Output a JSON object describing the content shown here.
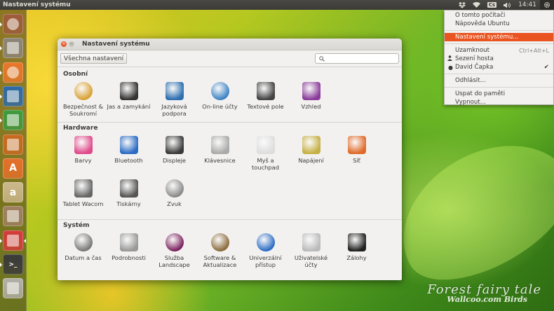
{
  "panel": {
    "app_title": "Nastavení systému",
    "clock": "14:41",
    "cs_badge": "Cs"
  },
  "launcher": {
    "items": [
      {
        "name": "dash-home",
        "icon": "ubuntu-icon",
        "color": "#9e5b3b"
      },
      {
        "name": "files",
        "icon": "files-icon",
        "color": "#8d8577"
      },
      {
        "name": "firefox",
        "icon": "firefox-icon",
        "color": "#e8772a"
      },
      {
        "name": "writer",
        "icon": "writer-icon",
        "color": "#2d6aa8"
      },
      {
        "name": "calc",
        "icon": "calc-icon",
        "color": "#3e9a3e"
      },
      {
        "name": "impress",
        "icon": "impress-icon",
        "color": "#c96a1f"
      },
      {
        "name": "software-center",
        "icon": "software-center-icon",
        "color": "#e6702a",
        "glyph": "A"
      },
      {
        "name": "amazon",
        "icon": "amazon-icon",
        "color": "#cdb88c",
        "glyph": "a"
      },
      {
        "name": "dosbox",
        "icon": "dosbox-icon",
        "color": "#a08060"
      },
      {
        "name": "system-settings",
        "icon": "system-settings-icon",
        "color": "#d43b3b"
      },
      {
        "name": "terminal",
        "icon": "terminal-icon",
        "color": "#3a3a3a",
        "glyph": ">_"
      },
      {
        "name": "drive",
        "icon": "drive-icon",
        "color": "#b3b0a8"
      }
    ]
  },
  "window": {
    "title": "Nastavení systému",
    "all_settings": "Všechna nastavení",
    "search_placeholder": "",
    "sections": [
      {
        "title": "Osobní",
        "items": [
          {
            "label": "Bezpečnost & Soukromí",
            "icon": "security-privacy-icon",
            "color": "#d8a030"
          },
          {
            "label": "Jas a zamykání",
            "icon": "brightness-lock-icon",
            "color": "#333333"
          },
          {
            "label": "Jazyková podpora",
            "icon": "language-support-icon",
            "color": "#2f6fb0"
          },
          {
            "label": "On-line účty",
            "icon": "online-accounts-icon",
            "color": "#3b82c4"
          },
          {
            "label": "Textové pole",
            "icon": "text-entry-icon",
            "color": "#444444"
          },
          {
            "label": "Vzhled",
            "icon": "appearance-icon",
            "color": "#8a3c9a"
          }
        ]
      },
      {
        "title": "Hardware",
        "items": [
          {
            "label": "Barvy",
            "icon": "color-icon",
            "color": "#e04a8a"
          },
          {
            "label": "Bluetooth",
            "icon": "bluetooth-icon",
            "color": "#2b6cc4"
          },
          {
            "label": "Displeje",
            "icon": "displays-icon",
            "color": "#3a3a3a"
          },
          {
            "label": "Klávesnice",
            "icon": "keyboard-icon",
            "color": "#aaaaaa"
          },
          {
            "label": "Myš a touchpad",
            "icon": "mouse-touchpad-icon",
            "color": "#dddddd"
          },
          {
            "label": "Napájení",
            "icon": "power-icon",
            "color": "#c6b046"
          },
          {
            "label": "Síť",
            "icon": "network-icon",
            "color": "#e06a2a"
          },
          {
            "label": "Tablet Wacom",
            "icon": "wacom-tablet-icon",
            "color": "#666666"
          },
          {
            "label": "Tiskárny",
            "icon": "printers-icon",
            "color": "#555555"
          },
          {
            "label": "Zvuk",
            "icon": "sound-icon",
            "color": "#888888"
          }
        ]
      },
      {
        "title": "Systém",
        "items": [
          {
            "label": "Datum a čas",
            "icon": "date-time-icon",
            "color": "#777777"
          },
          {
            "label": "Podrobnosti",
            "icon": "details-icon",
            "color": "#999999"
          },
          {
            "label": "Služba Landscape",
            "icon": "landscape-service-icon",
            "color": "#7a1f5c"
          },
          {
            "label": "Software & Aktualizace",
            "icon": "software-updates-icon",
            "color": "#8a6a3a"
          },
          {
            "label": "Univerzální přístup",
            "icon": "universal-access-icon",
            "color": "#2b6cc4"
          },
          {
            "label": "Uživatelské účty",
            "icon": "user-accounts-icon",
            "color": "#bbbbbb"
          },
          {
            "label": "Zálohy",
            "icon": "backups-icon",
            "color": "#222222"
          }
        ]
      }
    ]
  },
  "menu": {
    "about": "O tomto počítači",
    "help": "Nápověda Ubuntu",
    "system_settings": "Nastavení systému...",
    "lock": "Uzamknout",
    "lock_accel": "Ctrl+Alt+L",
    "guest": "Sezení hosta",
    "user": "David Čapka",
    "logout": "Odhlásit...",
    "suspend": "Uspat do paměti",
    "shutdown": "Vypnout..."
  },
  "watermark": {
    "line1": "Forest fairy tale",
    "line2a": "Wallcoo",
    "line2b": ".com",
    "line2c": "Birds"
  },
  "colors": {
    "accent": "#e95420",
    "panel": "#3c3b37",
    "window_bg": "#f2f1f0"
  }
}
